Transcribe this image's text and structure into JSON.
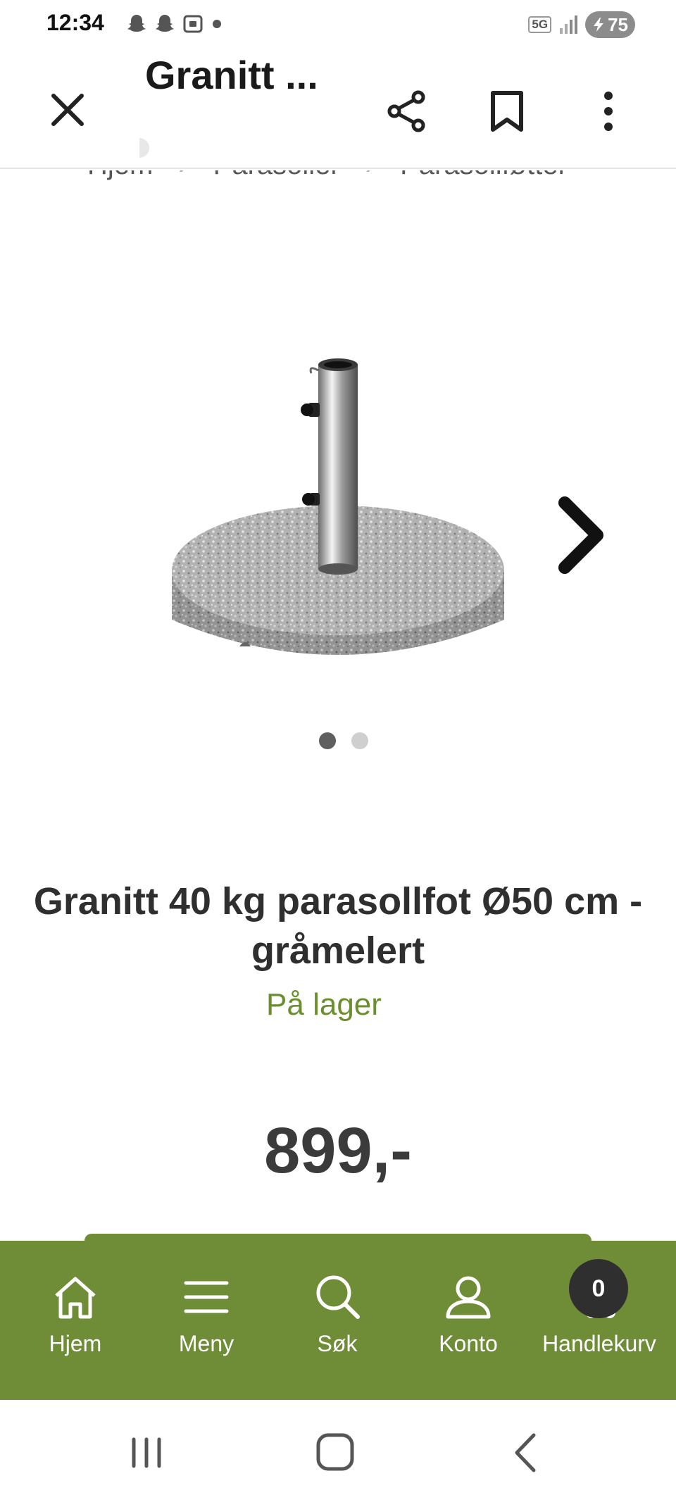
{
  "status_bar": {
    "time": "12:34",
    "network": "5G",
    "battery": "75",
    "notification_icons": [
      "snapchat-icon",
      "snapchat-icon",
      "screenshot-icon",
      "dot-icon"
    ]
  },
  "app_bar": {
    "title": "Granitt ...",
    "icons": [
      "close-icon",
      "share-icon",
      "bookmark-icon",
      "more-vert-icon"
    ]
  },
  "breadcrumb": {
    "items": [
      "Hjem",
      "Parasoller",
      "Parasollføtter"
    ],
    "separator": "›"
  },
  "gallery": {
    "image_alt": "granite-parasol-base",
    "dot_count": 2,
    "active_dot": 0
  },
  "product": {
    "title": "Granitt 40 kg parasollfot Ø50 cm - gråmelert",
    "stock": "På lager",
    "price": "899,-"
  },
  "site_nav": {
    "items": [
      {
        "label": "Hjem",
        "icon": "home-icon"
      },
      {
        "label": "Meny",
        "icon": "menu-icon"
      },
      {
        "label": "Søk",
        "icon": "search-icon"
      },
      {
        "label": "Konto",
        "icon": "account-icon"
      },
      {
        "label": "Handlekurv",
        "icon": "cart-icon"
      }
    ],
    "cart_count": "0"
  },
  "system_nav": [
    "recents-icon",
    "home-icon",
    "back-icon"
  ],
  "colors": {
    "brand_green": "#6f8c36",
    "stock_green": "#6b8e2e",
    "text_dark": "#2f2f2f",
    "badge_dark": "#2f2f2f"
  }
}
